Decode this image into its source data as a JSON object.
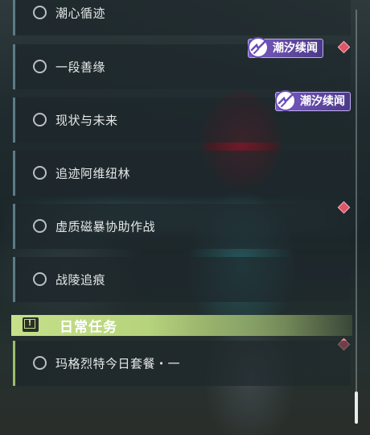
{
  "quests": [
    {
      "label": "潮心循迹"
    },
    {
      "label": "一段善缘"
    },
    {
      "label": "现状与未来"
    },
    {
      "label": "追迹阿维纽林"
    },
    {
      "label": "虚质磁暴协助作战"
    },
    {
      "label": "战陵追痕"
    }
  ],
  "badges": [
    {
      "label": "潮汐续闻",
      "icon": "tidal-sequel-icon"
    },
    {
      "label": "潮汐续闻",
      "icon": "tidal-sequel-icon"
    }
  ],
  "daily_section": {
    "title": "日常任务",
    "icon": "!"
  },
  "daily_quests": [
    {
      "label": "玛格烈特今日套餐・一"
    }
  ],
  "colors": {
    "accent_green": "#c6e08a",
    "badge_purple": "#7a5cc4",
    "alert_red": "#e0556a"
  }
}
